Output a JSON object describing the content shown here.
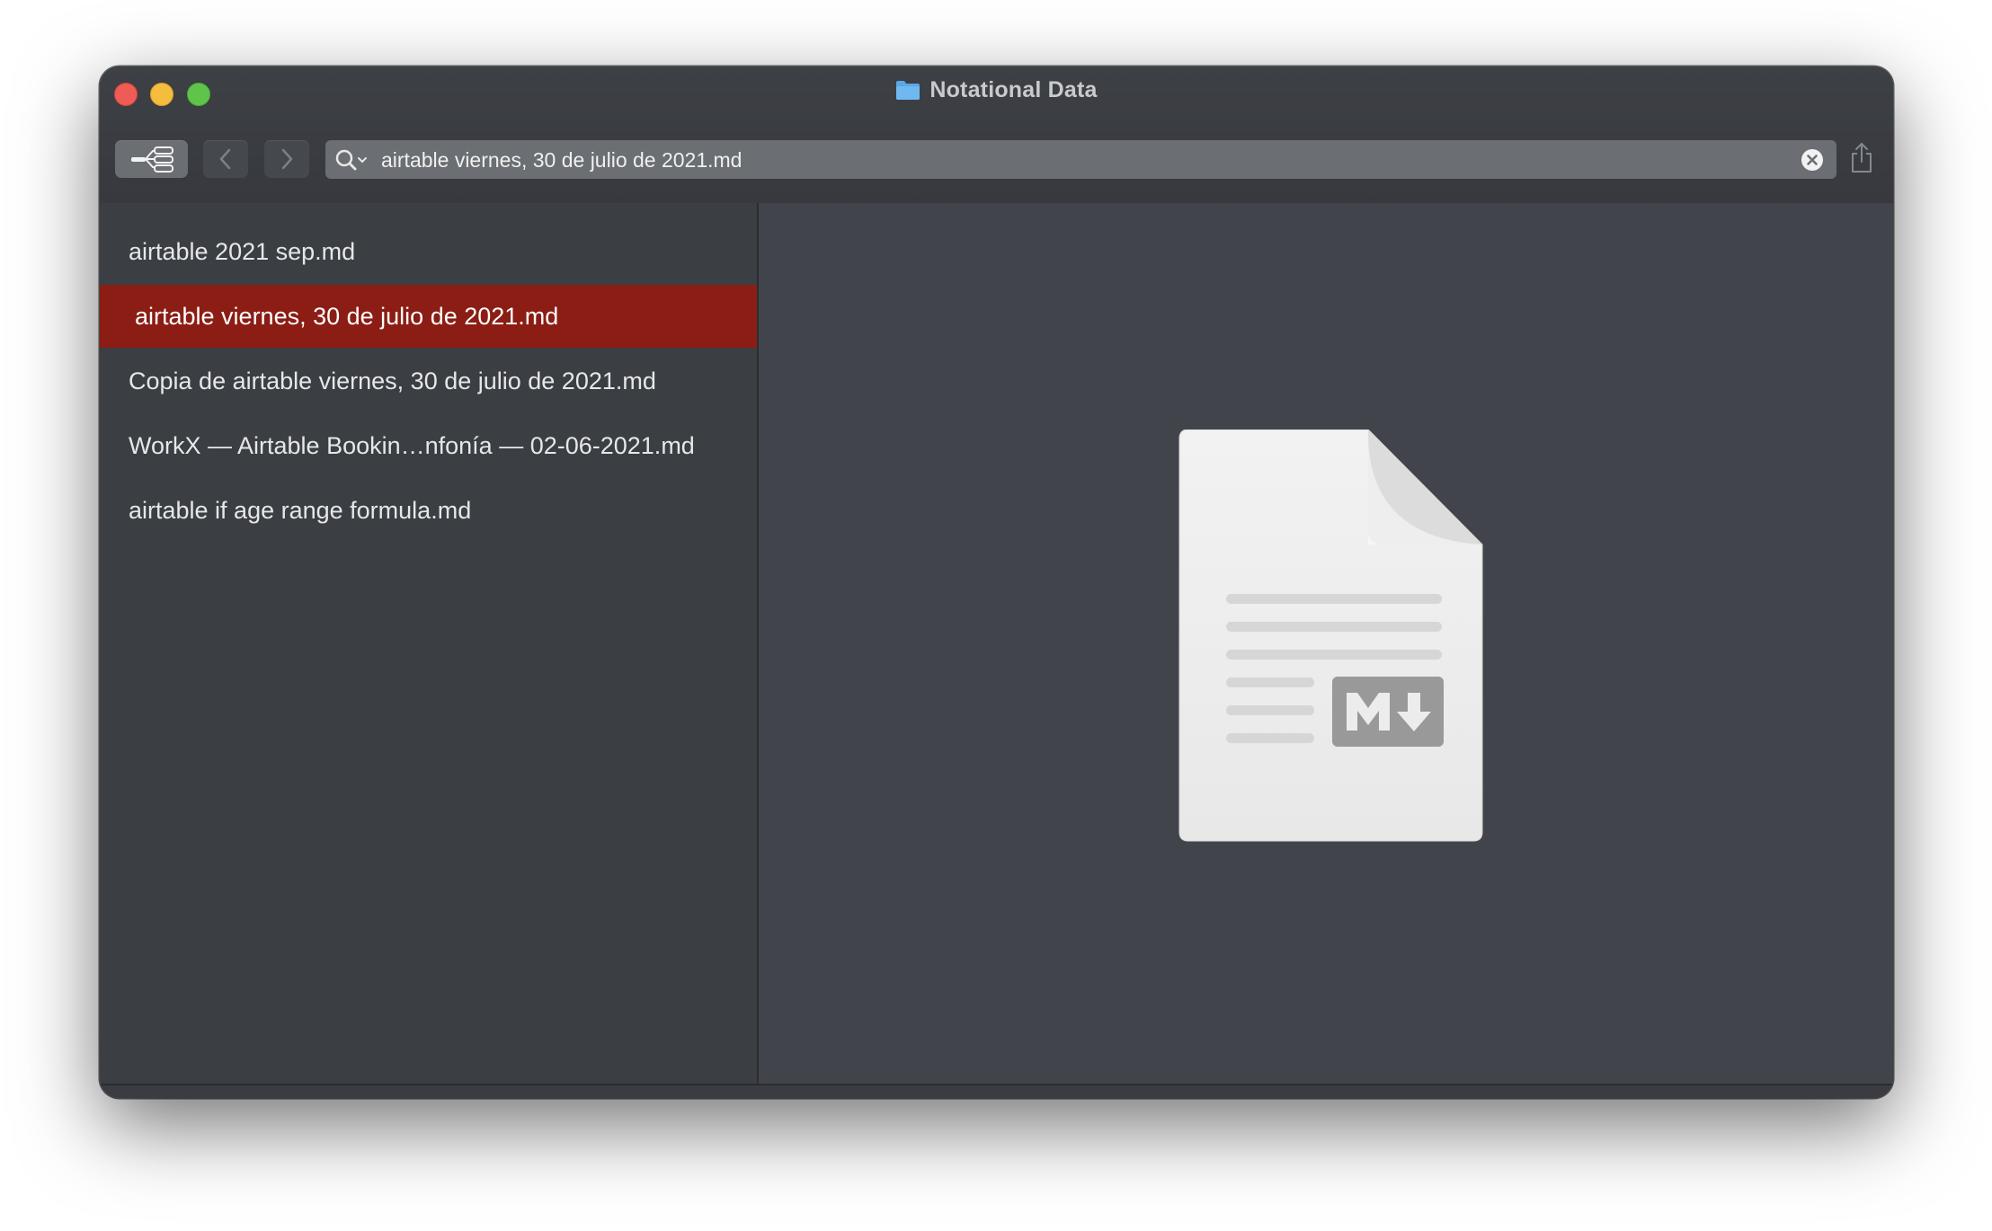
{
  "window": {
    "title": "Notational Data"
  },
  "toolbar": {
    "tree_button_icon": "list-tree-icon",
    "back_icon": "chevron-left-icon",
    "forward_icon": "chevron-right-icon",
    "share_icon": "share-icon"
  },
  "search": {
    "value": "airtable viernes, 30 de julio de 2021.md",
    "icon": "search-icon",
    "clear_icon": "clear-icon"
  },
  "notes": [
    {
      "title": "airtable 2021 sep.md",
      "selected": false
    },
    {
      "title": " airtable viernes, 30 de julio de 2021.md",
      "selected": true
    },
    {
      "title": "Copia de  airtable viernes, 30 de julio de 2021.md",
      "selected": false
    },
    {
      "title": "WorkX — Airtable Bookin…nfonía — 02-06-2021.md",
      "selected": false
    },
    {
      "title": "airtable if age range formula.md",
      "selected": false
    }
  ],
  "preview": {
    "icon": "markdown-document-icon",
    "badge_icon": "markdown-badge-icon"
  },
  "colors": {
    "selection": "#8b1d14",
    "window_bg": "#3b3e43",
    "folder": "#5aa8e6"
  }
}
